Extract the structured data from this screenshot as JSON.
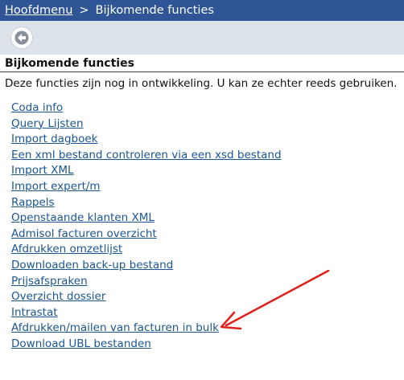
{
  "breadcrumb": {
    "home": "Hoofdmenu",
    "separator": ">",
    "current": "Bijkomende functies"
  },
  "toolbar": {
    "back_icon": "arrow-left-icon"
  },
  "section": {
    "title": "Bijkomende functies",
    "description": "Deze functies zijn nog in ontwikkeling. U kan ze echter reeds gebruiken."
  },
  "links": [
    "Coda info",
    "Query Lijsten",
    "Import dagboek",
    "Een xml bestand controleren via een xsd bestand",
    "Import XML",
    "Import expert/m",
    "Rappels",
    "Openstaande klanten XML",
    "Admisol facturen overzicht",
    "Afdrukken omzetlijst",
    "Downloaden back-up bestand",
    "Prijsafspraken",
    "Overzicht dossier",
    "Intrastat",
    "Afdrukken/mailen van facturen in bulk",
    "Download UBL bestanden"
  ],
  "colors": {
    "header_bg": "#2f5597",
    "toolbar_bg": "#dde3ea",
    "link": "#1a5694",
    "annotation_arrow": "#e0201b"
  }
}
